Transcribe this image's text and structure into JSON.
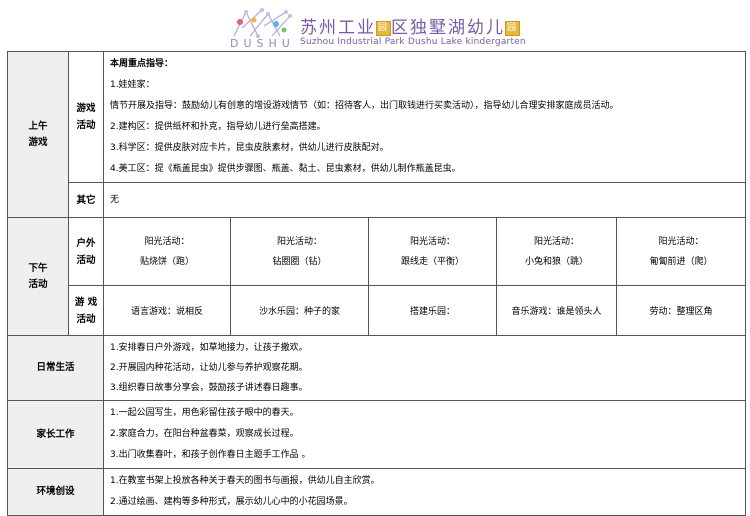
{
  "header": {
    "school_name": "苏州工业",
    "school_badge_1": "园",
    "school_name_2": "区独墅湖幼儿",
    "school_badge_2": "园",
    "school_subtitle": "Suzhou Industrial Park Dushu Lake kindergarten",
    "logo_text": "DUSHU"
  },
  "morning": {
    "section_label": [
      "上午",
      "游戏"
    ],
    "play_label": [
      "游戏",
      "活动"
    ],
    "play_lines": [
      "本周重点指导：",
      "1.娃娃家：",
      "情节开展及指导：鼓励幼儿有创意的增设游戏情节（如：招待客人，出门取钱进行买卖活动），指导幼儿合理安排家庭成员活动。",
      "2.建构区：提供纸杯和扑克，指导幼儿进行垒高搭建。",
      "3.科学区：提供皮肤对应卡片，昆虫皮肤素材，供幼儿进行皮肤配对。",
      "4.美工区：提《瓶盖昆虫》提供步骤图、瓶盖、黏土、昆虫素材，供幼儿制作瓶盖昆虫。"
    ],
    "other_label": "其它",
    "other_value": "无"
  },
  "afternoon": {
    "section_label": [
      "下午",
      "活动"
    ],
    "outdoor_label": [
      "户外",
      "活动"
    ],
    "outdoor": [
      {
        "title": "阳光活动：",
        "name": "贴烧饼（跑）"
      },
      {
        "title": "阳光活动：",
        "name": "钻圈圈（钻）"
      },
      {
        "title": "阳光活动：",
        "name": "跟线走（平衡）"
      },
      {
        "title": "阳光活动：",
        "name": "小兔和狼（跳）"
      },
      {
        "title": "阳光活动：",
        "name": "匍匐前进（爬）"
      }
    ],
    "games_label": [
      "游 戏",
      "活动"
    ],
    "games": [
      "语言游戏：说相反",
      "沙水乐园：种子的家",
      "搭建乐园：",
      "音乐游戏：谁是领头人",
      "劳动：整理区角"
    ]
  },
  "daily": {
    "label": "日常生活",
    "lines": [
      "1.安排春日户外游戏，如草地接力，让孩子撒欢。",
      "2.开展园内种花活动，让幼儿参与养护观察花期。",
      "3.组织春日故事分享会，鼓励孩子讲述春日趣事。"
    ]
  },
  "parents": {
    "label": "家长工作",
    "lines": [
      "1.一起公园写生，用色彩留住孩子眼中的春天。",
      "2.家庭合力，在阳台种盆春菜，观察成长过程。",
      "3.出门收集春叶，和孩子创作春日主题手工作品 。"
    ]
  },
  "environment": {
    "label": "环境创设",
    "lines": [
      "1.在教室书架上投放各种关于春天的图书与画报，供幼儿自主欣赏。",
      "2.通过绘画、建构等多种形式，展示幼儿心中的小花园场景。"
    ]
  },
  "colors": {
    "logo_purple": "#7a5aa6",
    "badge_gold": "#e6b83a",
    "section_gray": "#efefef"
  }
}
